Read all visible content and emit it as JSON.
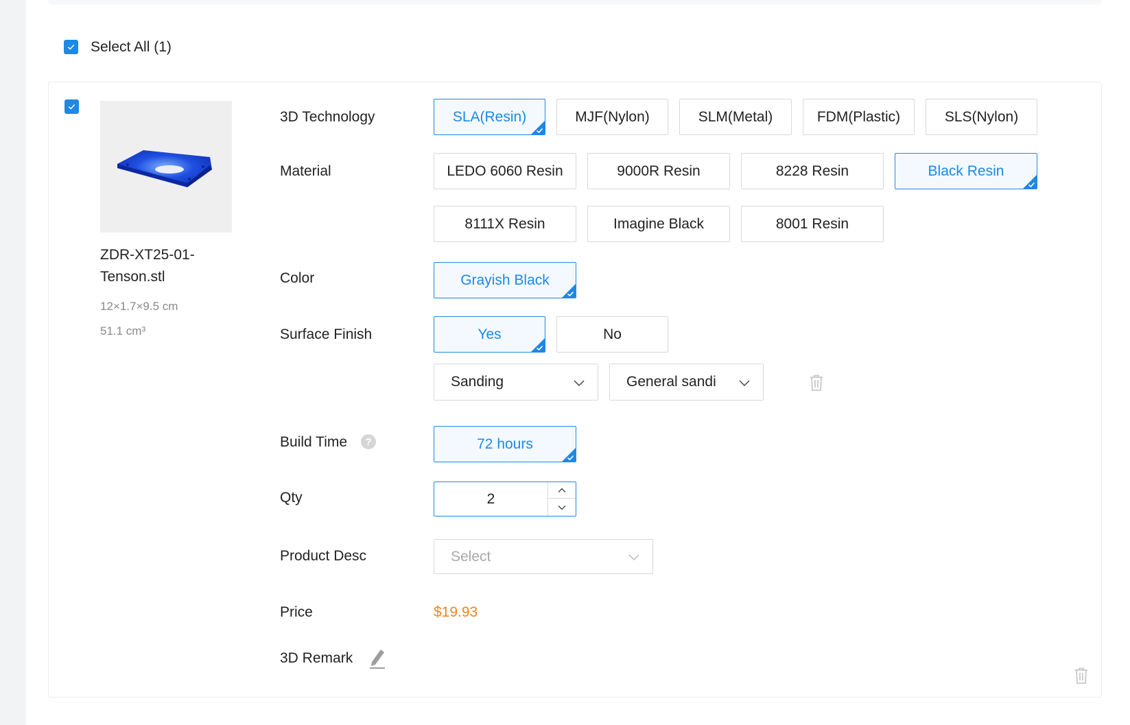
{
  "select_all": {
    "label": "Select All (1)",
    "checked": true
  },
  "item": {
    "checked": true,
    "file_name": "ZDR-XT25-01-Tenson.stl",
    "dimensions": "12×1.7×9.5 cm",
    "volume": "51.1 cm³",
    "technology": {
      "label": "3D Technology",
      "options": [
        "SLA(Resin)",
        "MJF(Nylon)",
        "SLM(Metal)",
        "FDM(Plastic)",
        "SLS(Nylon)"
      ],
      "selected": "SLA(Resin)"
    },
    "material": {
      "label": "Material",
      "options": [
        "LEDO 6060 Resin",
        "9000R Resin",
        "8228 Resin",
        "Black Resin",
        "8111X Resin",
        "Imagine Black",
        "8001 Resin"
      ],
      "selected": "Black Resin"
    },
    "color": {
      "label": "Color",
      "options": [
        "Grayish Black"
      ],
      "selected": "Grayish Black"
    },
    "surface_finish": {
      "label": "Surface Finish",
      "options": [
        "Yes",
        "No"
      ],
      "selected": "Yes",
      "finish_type": "Sanding",
      "finish_detail": "General sandi"
    },
    "build_time": {
      "label": "Build Time",
      "help": "?",
      "options": [
        "72 hours"
      ],
      "selected": "72 hours"
    },
    "qty": {
      "label": "Qty",
      "value": "2"
    },
    "product_desc": {
      "label": "Product Desc",
      "placeholder": "Select"
    },
    "price": {
      "label": "Price",
      "value": "$19.93"
    },
    "remark": {
      "label": "3D Remark"
    }
  },
  "colors": {
    "accent": "#1e88e5",
    "price": "#f5821f",
    "model": "#1f4fe0"
  },
  "icons": [
    "check-icon",
    "chevron-down-icon",
    "chevron-up-icon",
    "trash-icon",
    "pencil-icon",
    "question-icon"
  ]
}
